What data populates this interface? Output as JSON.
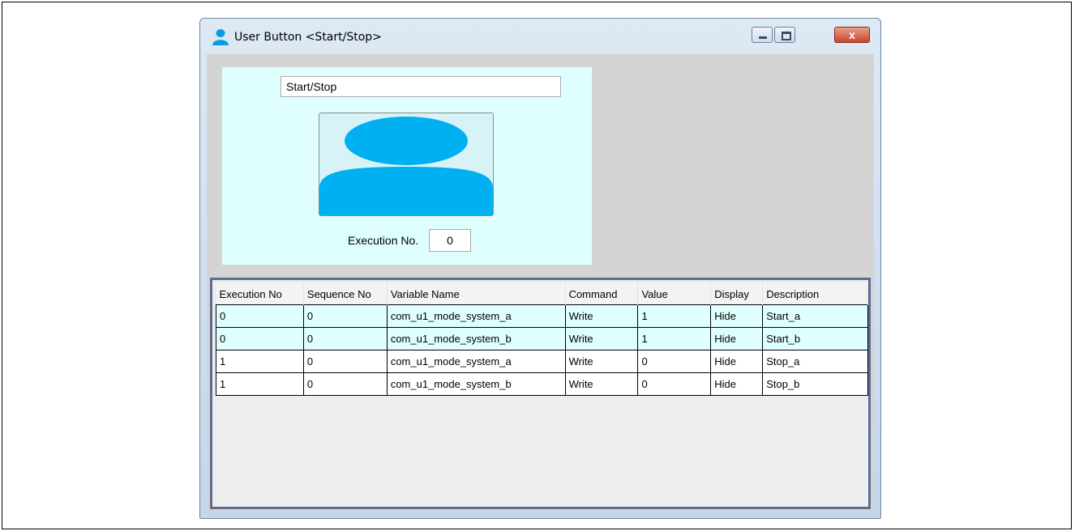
{
  "window": {
    "title": "User Button <Start/Stop>",
    "close_glyph": "x"
  },
  "preview": {
    "button_name": "Start/Stop",
    "execution_label": "Execution No.",
    "execution_value": "0",
    "icon": "user-silhouette-icon",
    "icon_color": "#00b0f0",
    "background_color": "#dffffe"
  },
  "table": {
    "columns": [
      "Execution No",
      "Sequence No",
      "Variable Name",
      "Command",
      "Value",
      "Display",
      "Description"
    ],
    "rows": [
      {
        "highlight": true,
        "cells": [
          "0",
          "0",
          "com_u1_mode_system_a",
          "Write",
          "1",
          "Hide",
          "Start_a"
        ]
      },
      {
        "highlight": true,
        "cells": [
          "0",
          "0",
          "com_u1_mode_system_b",
          "Write",
          "1",
          "Hide",
          "Start_b"
        ]
      },
      {
        "highlight": false,
        "cells": [
          "1",
          "0",
          "com_u1_mode_system_a",
          "Write",
          "0",
          "Hide",
          "Stop_a"
        ]
      },
      {
        "highlight": false,
        "cells": [
          "1",
          "0",
          "com_u1_mode_system_b",
          "Write",
          "0",
          "Hide",
          "Stop_b"
        ]
      }
    ]
  }
}
